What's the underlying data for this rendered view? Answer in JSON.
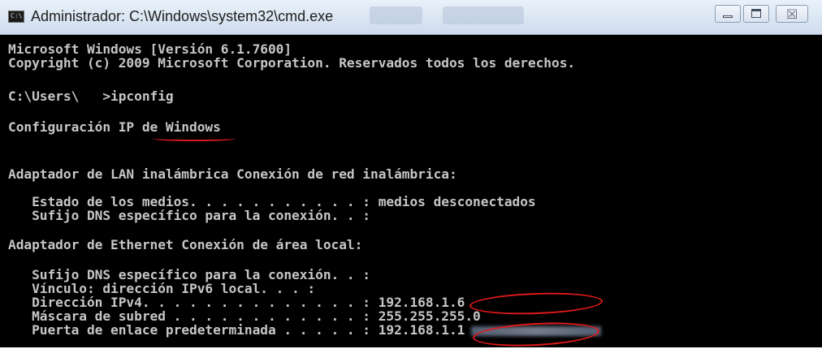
{
  "window": {
    "title": "Administrador: C:\\Windows\\system32\\cmd.exe",
    "icon_label": "C:\\"
  },
  "console": {
    "lines": [
      "Microsoft Windows [Versión 6.1.7600]",
      "Copyright (c) 2009 Microsoft Corporation. Reservados todos los derechos.",
      "C:\\Users\\   >ipconfig",
      "Configuración IP de Windows",
      "Adaptador de LAN inalámbrica Conexión de red inalámbrica:",
      "   Estado de los medios. . . . . . . . . . . : medios desconectados",
      "   Sufijo DNS específico para la conexión. . :",
      "Adaptador de Ethernet Conexión de área local:",
      "   Sufijo DNS específico para la conexión. . :",
      "   Vínculo: dirección IPv6 local. . . : ",
      "   Dirección IPv4. . . . . . . . . . . . . . : 192.168.1.6",
      "   Máscara de subred . . . . . . . . . . . . : 255.255.255.0",
      "   Puerta de enlace predeterminada . . . . . : 192.168.1.1"
    ]
  },
  "colors": {
    "console_bg": "#000000",
    "console_text": "#c6c6c6",
    "annotation": "#e0191b"
  },
  "icons": [
    "console-icon",
    "minimize-icon",
    "maximize-icon",
    "close-icon"
  ]
}
